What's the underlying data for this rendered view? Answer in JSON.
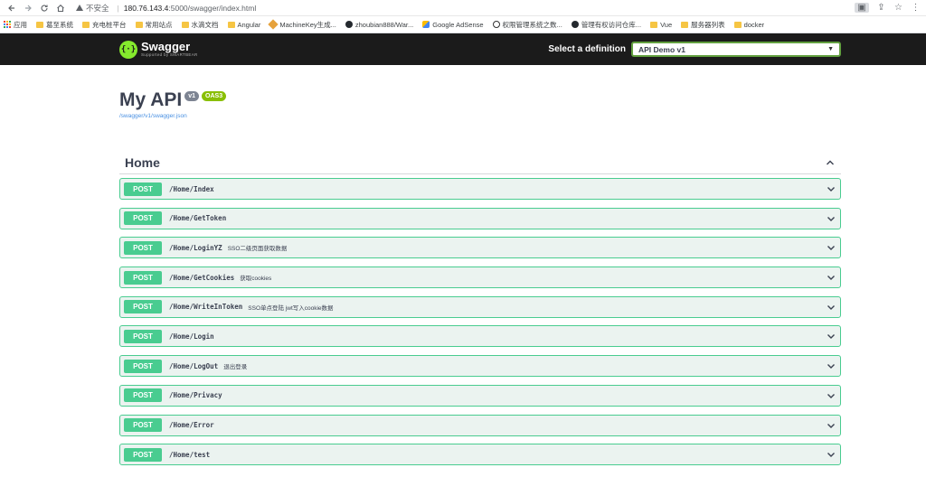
{
  "browser": {
    "security_label": "不安全",
    "url_host": "180.76.143.4",
    "url_path": ":5000/swagger/index.html"
  },
  "bookmarks": [
    {
      "label": "应用",
      "icon": "apps-icon"
    },
    {
      "label": "葛至系统",
      "icon": "folder-icon"
    },
    {
      "label": "充电桩平台",
      "icon": "folder-icon"
    },
    {
      "label": "常用站点",
      "icon": "folder-icon"
    },
    {
      "label": "水滴文档",
      "icon": "folder-icon"
    },
    {
      "label": "Angular",
      "icon": "folder-icon"
    },
    {
      "label": "MachineKey生成...",
      "icon": "machinekey-icon"
    },
    {
      "label": "zhoubian888/War...",
      "icon": "github-icon"
    },
    {
      "label": "Google AdSense",
      "icon": "adsense-icon"
    },
    {
      "label": "权限管理系统之数...",
      "icon": "pm-icon"
    },
    {
      "label": "管理有权访问仓库...",
      "icon": "github-icon"
    },
    {
      "label": "Vue",
      "icon": "folder-icon"
    },
    {
      "label": "服务器列表",
      "icon": "folder-icon"
    },
    {
      "label": "docker",
      "icon": "folder-icon"
    }
  ],
  "topbar": {
    "logo_title": "Swagger",
    "logo_sub": "Supported by SMARTBEAR",
    "definition_label": "Select a definition",
    "definition_value": "API Demo v1"
  },
  "info": {
    "title": "My API",
    "version_badge": "v1",
    "oas_badge": "OAS3",
    "spec_link": "/swagger/v1/swagger.json"
  },
  "section": {
    "title": "Home",
    "operations": [
      {
        "method": "POST",
        "path": "/Home/Index",
        "summary": ""
      },
      {
        "method": "POST",
        "path": "/Home/GetToken",
        "summary": ""
      },
      {
        "method": "POST",
        "path": "/Home/LoginYZ",
        "summary": "SSO二级页面获取数据"
      },
      {
        "method": "POST",
        "path": "/Home/GetCookies",
        "summary": "获取cookies"
      },
      {
        "method": "POST",
        "path": "/Home/WriteInToken",
        "summary": "SSO单点登陆 jwt写入cookie数据"
      },
      {
        "method": "POST",
        "path": "/Home/Login",
        "summary": ""
      },
      {
        "method": "POST",
        "path": "/Home/LogOut",
        "summary": "退出登录"
      },
      {
        "method": "POST",
        "path": "/Home/Privacy",
        "summary": ""
      },
      {
        "method": "POST",
        "path": "/Home/Error",
        "summary": ""
      },
      {
        "method": "POST",
        "path": "/Home/test",
        "summary": ""
      }
    ]
  },
  "colors": {
    "post_green": "#49cc90",
    "post_bg": "#ebf3f0",
    "topbar_bg": "#1b1b1b",
    "swagger_green": "#85ea2d"
  }
}
